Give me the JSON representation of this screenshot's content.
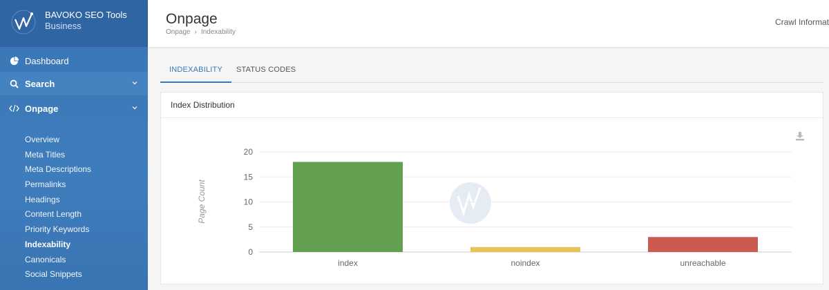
{
  "sidebar": {
    "brand_title": "BAVOKO SEO Tools",
    "brand_sub": "Business",
    "nav": {
      "dashboard": "Dashboard",
      "search": "Search",
      "onpage": "Onpage"
    },
    "sub_items": [
      "Overview",
      "Meta Titles",
      "Meta Descriptions",
      "Permalinks",
      "Headings",
      "Content Length",
      "Priority Keywords",
      "Indexability",
      "Canonicals",
      "Social Snippets"
    ],
    "active_sub": "Indexability"
  },
  "header": {
    "title": "Onpage",
    "breadcrumb": [
      "Onpage",
      "Indexability"
    ],
    "right_text": "Crawl Informat"
  },
  "tabs": [
    "INDEXABILITY",
    "STATUS CODES"
  ],
  "card": {
    "title": "Index Distribution"
  },
  "colors": {
    "accent": "#3a75b4",
    "index": "#62a050",
    "noindex": "#e6c257",
    "unreachable": "#cc5a50"
  },
  "chart_data": {
    "type": "bar",
    "categories": [
      "index",
      "noindex",
      "unreachable"
    ],
    "values": [
      18,
      1,
      3
    ],
    "ylabel": "Page Count",
    "ylim": [
      0,
      20
    ],
    "yticks": [
      0,
      5,
      10,
      15,
      20
    ],
    "grid": true
  }
}
